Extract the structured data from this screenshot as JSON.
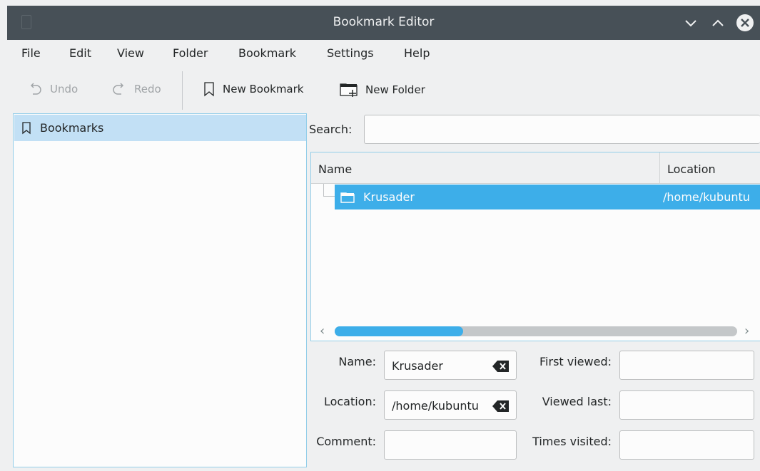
{
  "window": {
    "title": "Bookmark Editor"
  },
  "menu": [
    "File",
    "Edit",
    "View",
    "Folder",
    "Bookmark",
    "Settings",
    "Help"
  ],
  "toolbar": {
    "undo": "Undo",
    "redo": "Redo",
    "new_bookmark": "New Bookmark",
    "new_folder": "New Folder"
  },
  "tree": {
    "root": "Bookmarks"
  },
  "search": {
    "label": "Search:",
    "value": ""
  },
  "list": {
    "columns": [
      "Name",
      "Location"
    ],
    "rows": [
      {
        "name": "Krusader",
        "location": "/home/kubuntu"
      }
    ]
  },
  "form": {
    "name_label": "Name:",
    "name_value": "Krusader",
    "location_label": "Location:",
    "location_value": "/home/kubuntu",
    "comment_label": "Comment:",
    "comment_value": "",
    "first_viewed_label": "First viewed:",
    "first_viewed_value": "",
    "viewed_last_label": "Viewed last:",
    "viewed_last_value": "",
    "times_visited_label": "Times visited:",
    "times_visited_value": ""
  },
  "colors": {
    "accent": "#3daee9",
    "selection_light": "#c2e0f5",
    "titlebar": "#475057"
  }
}
